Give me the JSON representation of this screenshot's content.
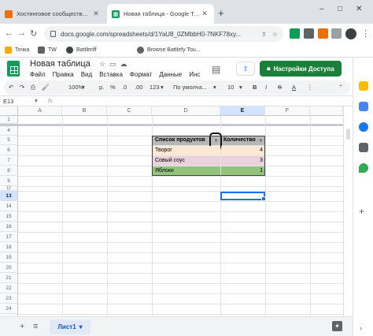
{
  "browser": {
    "tabs": [
      {
        "title": "Хостинговое сообщество «Tim",
        "active": false,
        "favicon_color": "#e8710a"
      },
      {
        "title": "Новая таблица - Google Табли",
        "active": true,
        "favicon_color": "#0f9d58"
      }
    ],
    "new_tab_label": "+",
    "window_controls": [
      "–",
      "□",
      "✕"
    ],
    "url": "docs.google.com/spreadsheets/d/1YaU8_0ZMbbH0-7NKF78xy...",
    "bookmarks": [
      {
        "label": "Точка",
        "color": "#f9ab00"
      },
      {
        "label": "TW",
        "color": "#5f6368"
      },
      {
        "label": "Battleriff",
        "color": "#3c4043"
      },
      {
        "label": "Browse Battlefy Tou...",
        "color": "#5f6368"
      }
    ]
  },
  "app": {
    "doc_title": "Новая таблица",
    "menu": [
      "Файл",
      "Правка",
      "Вид",
      "Вставка",
      "Формат",
      "Данные",
      "Инс"
    ],
    "share_label": "Настройки Доступа"
  },
  "toolbar": {
    "zoom": "100%",
    "currency": "р.",
    "percent": "%",
    "decimals_less": ".0",
    "decimals_more": ".00",
    "number_format": "123",
    "font": "По умолча...",
    "font_size": "10",
    "bold": "B",
    "italic": "I",
    "strike": "S",
    "text_color": "A"
  },
  "formula_bar": {
    "cell_ref": "E13",
    "fx": "fx",
    "value": ""
  },
  "grid": {
    "columns": [
      "A",
      "B",
      "C",
      "D",
      "E",
      "F"
    ],
    "selected_column": "E",
    "rows": [
      "1",
      "4",
      "5",
      "6",
      "7",
      "8",
      "9",
      "12",
      "13",
      "14",
      "15",
      "16",
      "17",
      "18",
      "19",
      "20",
      "21",
      "22",
      "23",
      "24",
      "25"
    ],
    "selected_row": "13"
  },
  "table": {
    "header_product": "Список продуктов",
    "header_quantity": "Количество",
    "rows": [
      {
        "product": "Творог",
        "quantity": "4",
        "color": "#fce8d4"
      },
      {
        "product": "Совый соус",
        "quantity": "3",
        "color": "#ead1dc"
      },
      {
        "product": "Яблоки",
        "quantity": "1",
        "color": "#93c47d"
      }
    ],
    "header_color": "#b7b7b7"
  },
  "sheets": {
    "active_sheet": "Лист1"
  }
}
